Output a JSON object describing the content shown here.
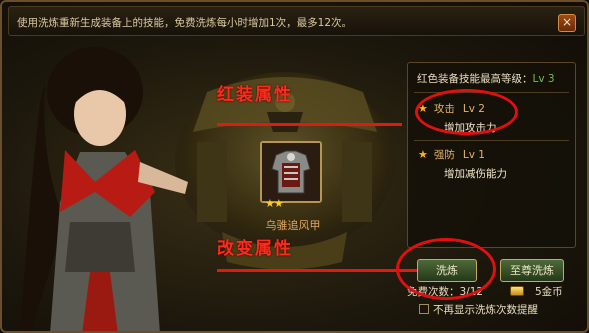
{
  "header": {
    "hint": "使用洗炼重新生成装备上的技能，免费洗炼每小时增加1次，最多12次。",
    "close_label": "×"
  },
  "annotations": {
    "red_equip_attr": "红装属性",
    "change_attr": "改变属性"
  },
  "item": {
    "name": "乌骓追风甲",
    "stars": "★★",
    "icon": "armor-icon"
  },
  "skills_panel": {
    "title": "红色装备技能最高等级：",
    "max_level": "Lv 3",
    "skills": [
      {
        "name": "攻击",
        "level": "Lv 2",
        "desc": "增加攻击力"
      },
      {
        "name": "强防",
        "level": "Lv 1",
        "desc": "增加减伤能力"
      }
    ]
  },
  "actions": {
    "refine_label": "洗炼",
    "premium_refine_label": "至尊洗炼",
    "free_count": "免费次数：3/12",
    "cost": "5金币",
    "no_show_label": "不再显示洗炼次数提醒"
  },
  "colors": {
    "annotation_red": "#e01010",
    "level_green": "#6fc045",
    "skill_gold": "#e4b468"
  }
}
